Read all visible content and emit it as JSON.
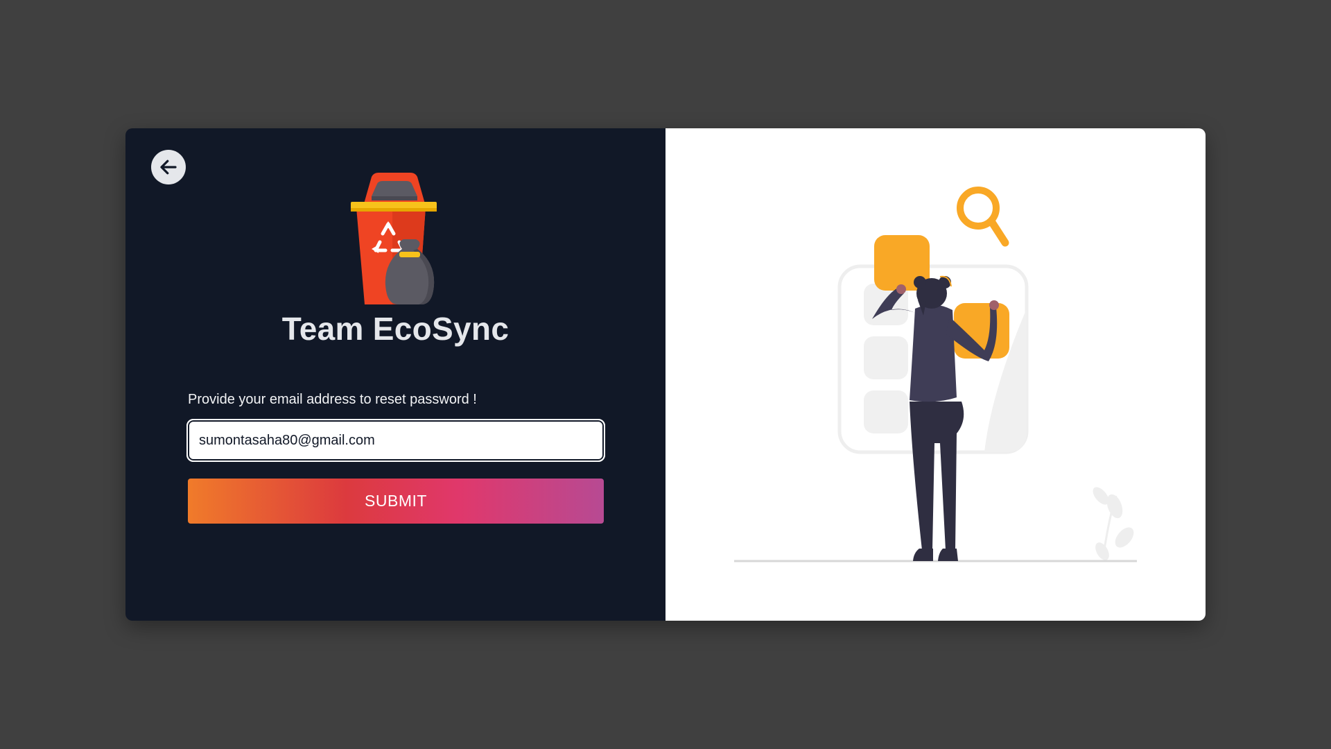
{
  "brand": {
    "title": "Team EcoSync",
    "logo_icon": "recycle-bin-icon"
  },
  "navigation": {
    "back_icon": "arrow-left-icon"
  },
  "form": {
    "prompt": "Provide your email address to reset password !",
    "email_value": "sumontasaha80@gmail.com",
    "submit_label": "SUBMIT"
  },
  "illustration": {
    "icon": "person-arranging-tiles-illustration"
  },
  "colors": {
    "page_background": "#404040",
    "panel_dark": "#111827",
    "panel_light": "#ffffff",
    "accent_orange": "#f9a826",
    "bin_red": "#ef4423",
    "button_gradient_start": "#f07b2a",
    "button_gradient_end": "#b74a93"
  }
}
